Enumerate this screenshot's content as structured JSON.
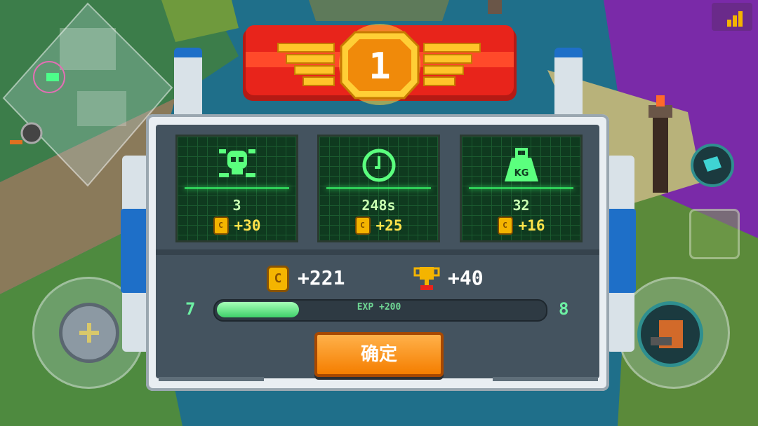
{
  "rank": {
    "place": "1"
  },
  "stats": [
    {
      "icon": "skull-crossbones-icon",
      "value": "3",
      "bonus": "+30"
    },
    {
      "icon": "clock-icon",
      "value": "248s",
      "bonus": "+25"
    },
    {
      "icon": "kg-weight-icon",
      "value": "32",
      "bonus": "+16",
      "icon_text": "KG"
    }
  ],
  "coin_symbol": "C",
  "totals": {
    "coins": "+221",
    "trophies": "+40"
  },
  "exp": {
    "current_level": "7",
    "next_level": "8",
    "label": "EXP +200",
    "progress": 0.25
  },
  "confirm_label": "确定",
  "colors": {
    "accent": "#f57e00",
    "screen_green": "#39ff6a",
    "banner_red": "#e8241b",
    "gold": "#f4b400"
  }
}
